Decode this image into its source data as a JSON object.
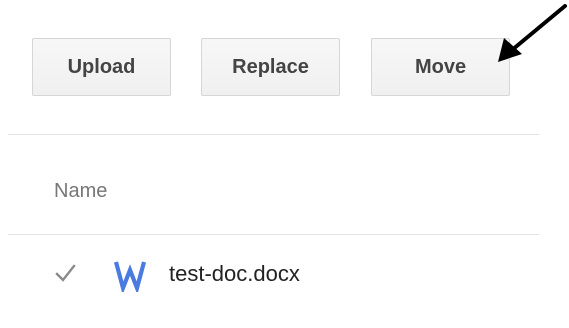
{
  "toolbar": {
    "upload_label": "Upload",
    "replace_label": "Replace",
    "move_label": "Move"
  },
  "file_list": {
    "column_header": "Name",
    "rows": [
      {
        "name": "test-doc.docx",
        "checked": true,
        "icon": "word-document-icon"
      }
    ]
  },
  "colors": {
    "word_icon": "#4a7be0",
    "button_border": "#d6d6d6",
    "button_bg": "#f3f3f3",
    "button_text": "#444444",
    "divider": "#e3e3e3"
  }
}
